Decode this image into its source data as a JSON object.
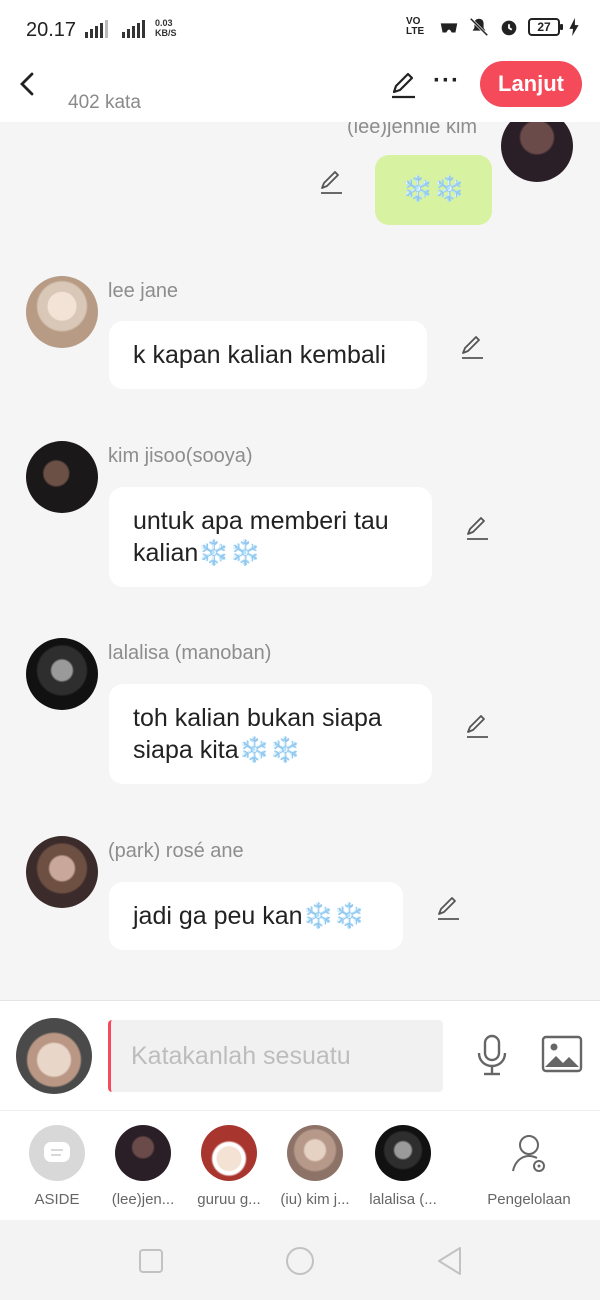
{
  "status_bar": {
    "time": "20.17",
    "network_type": "4G",
    "data_speed": "0.03",
    "data_unit": "KB/S",
    "volte": "VO LTE",
    "battery": "27",
    "icons": [
      "signal-icon",
      "signal-4g-icon",
      "game-icon",
      "mute-icon",
      "alarm-icon",
      "battery-icon",
      "charging-icon"
    ]
  },
  "header": {
    "word_count": "402 kata",
    "next_label": "Lanjut",
    "more_label": "···",
    "accent_color": "#f44a59"
  },
  "messages": [
    {
      "sender": "(lee)jennie kim",
      "text": "❄️❄️",
      "mine": true,
      "bubble_color": "#d7f2a0"
    },
    {
      "sender": "lee jane",
      "text": "k kapan kalian kembali",
      "mine": false
    },
    {
      "sender": "kim jisoo(sooya)",
      "text": "untuk apa memberi tau kalian❄️❄️",
      "mine": false
    },
    {
      "sender": "lalalisa (manoban)",
      "text": "toh kalian bukan siapa siapa kita❄️❄️",
      "mine": false
    },
    {
      "sender": "(park) rosé ane",
      "text": "jadi ga peu kan❄️❄️",
      "mine": false
    }
  ],
  "input": {
    "placeholder": "Katakanlah sesuatu"
  },
  "characters": [
    {
      "label": "ASIDE",
      "icon": "aside-icon"
    },
    {
      "label": "(lee)jen..."
    },
    {
      "label": "guruu g..."
    },
    {
      "label": "(iu) kim j..."
    },
    {
      "label": "lalalisa (..."
    },
    {
      "label": "Pengelolaan",
      "icon": "manage-user-icon"
    }
  ]
}
